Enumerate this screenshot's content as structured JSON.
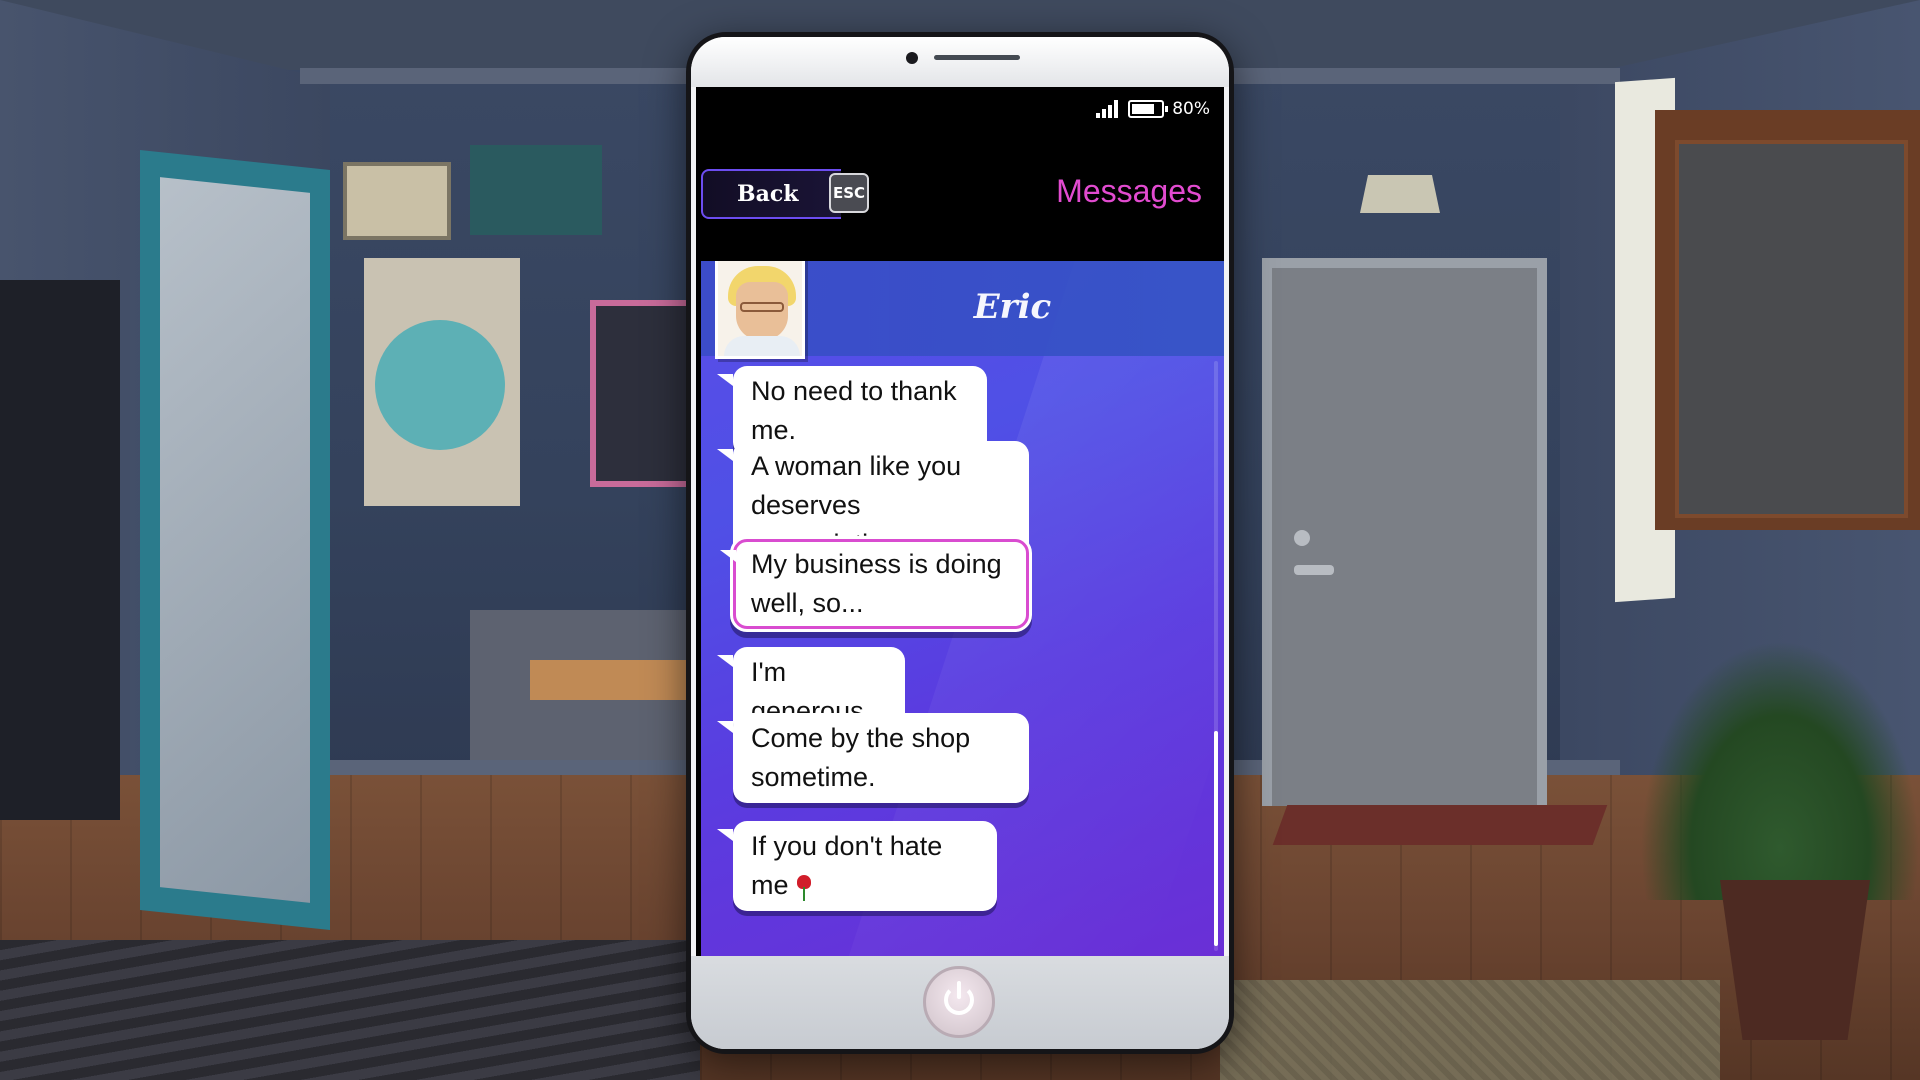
{
  "status": {
    "battery": "80%",
    "battery_level": 0.8
  },
  "header": {
    "back_label": "Back",
    "esc_label": "ESC",
    "title": "Messages"
  },
  "contact": {
    "name": "Eric"
  },
  "messages": [
    {
      "text": "No need to thank me.",
      "selected": false
    },
    {
      "text": "A woman like you deserves appreciation.",
      "selected": false
    },
    {
      "text": "My business is doing well, so...",
      "selected": true
    },
    {
      "text": "I'm generous.",
      "selected": false
    },
    {
      "text": "Come by the shop sometime.",
      "selected": false
    },
    {
      "text": "If you don't hate me",
      "selected": false,
      "icon": "rose-icon"
    }
  ],
  "colors": {
    "accent": "#e24bd0",
    "chat_bg": "#5a4ce8",
    "selected_border": "#d94cd0"
  }
}
